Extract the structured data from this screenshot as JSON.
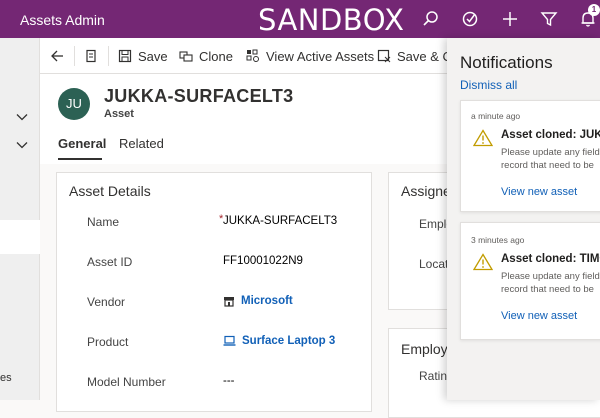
{
  "topbar": {
    "app_title": "Assets Admin",
    "environment": "SANDBOX",
    "notification_count": "1",
    "icons": [
      "search-icon",
      "task-icon",
      "plus-icon",
      "filter-icon",
      "bell-icon"
    ],
    "color": "#742774"
  },
  "leftnav": {
    "partial_label": "es"
  },
  "commandbar": {
    "back_icon": "back-arrow-icon",
    "form_icon": "form-icon",
    "save_label": "Save",
    "clone_label": "Clone",
    "view_active_label": "View Active Assets",
    "save_close_label": "Save & Cl"
  },
  "record": {
    "initials": "JU",
    "title": "JUKKA-SURFACELT3",
    "type": "Asset",
    "avatar_color": "#2c6154"
  },
  "tabs": [
    {
      "label": "General",
      "active": true
    },
    {
      "label": "Related",
      "active": false
    }
  ],
  "asset_details": {
    "title": "Asset Details",
    "fields": [
      {
        "label": "Name",
        "required": "*",
        "value": "JUKKA-SURFACELT3"
      },
      {
        "label": "Asset ID",
        "value": "FF10001022N9"
      },
      {
        "label": "Vendor",
        "value": "Microsoft",
        "link": true,
        "icon": "store-icon"
      },
      {
        "label": "Product",
        "value": "Surface Laptop 3",
        "link": true,
        "icon": "laptop-icon"
      },
      {
        "label": "Model Number",
        "value": "---"
      }
    ]
  },
  "assignee_card": {
    "title": "Assigne",
    "fields": [
      "Emplo",
      "Locati"
    ]
  },
  "employee_card": {
    "title": "Employe",
    "fields": [
      "Rating"
    ]
  },
  "notifications": {
    "title": "Notifications",
    "dismiss_all": "Dismiss all",
    "items": [
      {
        "time": "a minute ago",
        "heading": "Asset cloned: JUKKA",
        "body_line1": "Please update any field",
        "body_line2": "record that need to be",
        "link": "View new asset"
      },
      {
        "time": "3 minutes ago",
        "heading": "Asset cloned: TIMO",
        "body_line1": "Please update any field",
        "body_line2": "record that need to be",
        "link": "View new asset"
      }
    ]
  }
}
